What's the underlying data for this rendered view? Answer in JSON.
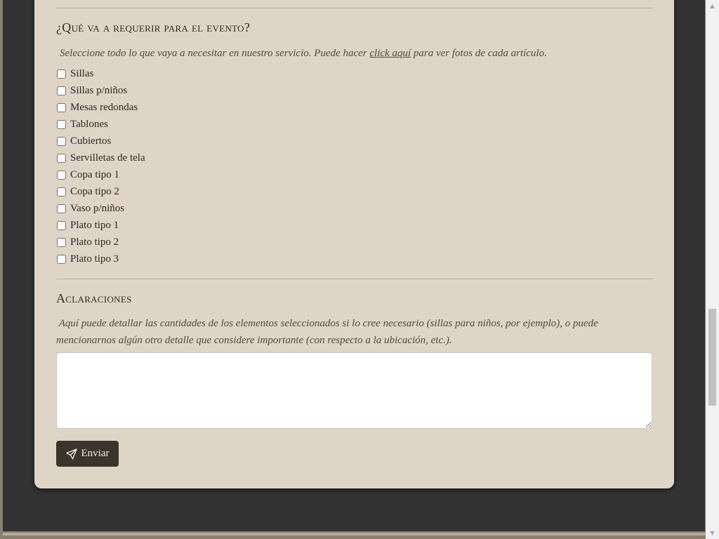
{
  "section_items": {
    "title": "¿Qué va a requerir para el evento?",
    "help_before": "Seleccione todo lo que vaya a necesitar en nuestro servicio. Puede hacer ",
    "help_link": "click aquí",
    "help_after": " para ver fotos de cada artículo.",
    "items": [
      {
        "label": "Sillas",
        "checked": false
      },
      {
        "label": "Sillas p/niños",
        "checked": false
      },
      {
        "label": "Mesas redondas",
        "checked": false
      },
      {
        "label": "Tablones",
        "checked": false
      },
      {
        "label": "Cubiertos",
        "checked": false
      },
      {
        "label": "Servilletas de tela",
        "checked": false
      },
      {
        "label": "Copa tipo 1",
        "checked": false
      },
      {
        "label": "Copa tipo 2",
        "checked": false
      },
      {
        "label": "Vaso p/niños",
        "checked": false
      },
      {
        "label": "Plato tipo 1",
        "checked": false
      },
      {
        "label": "Plato tipo 2",
        "checked": false
      },
      {
        "label": "Plato tipo 3",
        "checked": false
      }
    ]
  },
  "section_notes": {
    "title": "Aclaraciones",
    "help": "Aquí puede detallar las cantidades de los elementos seleccionados si lo cree necesario (sillas para niños, por ejemplo), o puede mencionarnos algún otro detalle que considere importante (con respecto a la ubicación, etc.).",
    "textarea_value": ""
  },
  "submit": {
    "label": "Enviar",
    "icon": "paper-plane-icon"
  },
  "colors": {
    "card_bg": "#ded5c6",
    "page_bg": "#323232",
    "button_bg": "#3b342d",
    "text": "#2c2824"
  }
}
